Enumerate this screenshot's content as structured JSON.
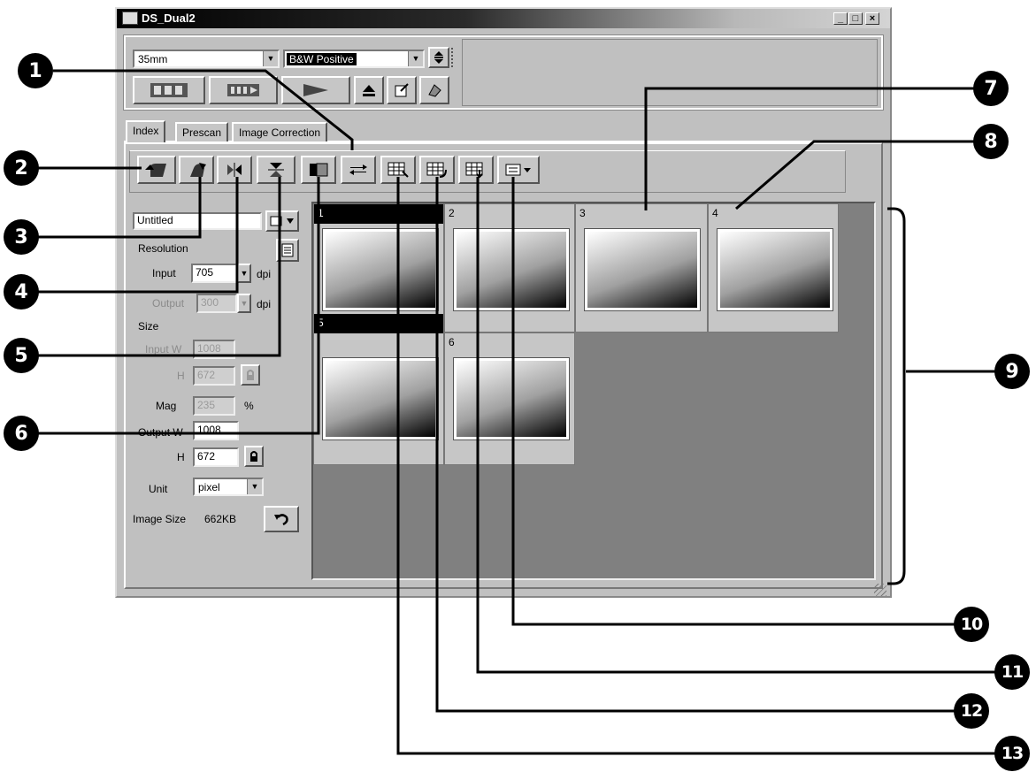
{
  "window": {
    "title": "DS_Dual2",
    "minimize": "_",
    "restore": "□",
    "close": "×"
  },
  "toolbar": {
    "film_type": "35mm",
    "color_mode": "B&W Positive",
    "buttons": [
      "index-scan-icon",
      "prescan-icon",
      "scan-icon",
      "eject-icon",
      "preferences-icon",
      "save-settings-icon"
    ]
  },
  "tabs": [
    "Index",
    "Prescan",
    "Image Correction"
  ],
  "left_panel": {
    "job_name": "Untitled",
    "resolution_label": "Resolution",
    "input_label": "Input",
    "input_value": "705",
    "input_unit": "dpi",
    "output_label": "Output",
    "output_value": "300",
    "output_unit": "dpi",
    "size_label": "Size",
    "input_w_label": "Input W",
    "input_w_value": "1008",
    "input_h_label": "H",
    "input_h_value": "672",
    "mag_label": "Mag",
    "mag_value": "235",
    "mag_unit": "%",
    "output_w_label": "Output W",
    "output_w_value": "1008",
    "output_h_label": "H",
    "output_h_value": "672",
    "unit_label": "Unit",
    "unit_value": "pixel",
    "image_size_label": "Image Size",
    "image_size_value": "662KB"
  },
  "frames": [
    "1",
    "2",
    "3",
    "4",
    "5",
    "6"
  ],
  "callouts": [
    "1",
    "2",
    "3",
    "4",
    "5",
    "6",
    "7",
    "8",
    "9",
    "10",
    "11",
    "12",
    "13"
  ],
  "icons": {
    "rotate_left": "rotate-left-icon",
    "rotate_right": "rotate-right-icon",
    "flip_horizontal": "flip-horizontal-icon",
    "flip_vertical": "flip-vertical-icon",
    "toggle_view": "toggle-view-icon",
    "swap": "swap-icon",
    "select_all": "select-all-frames-icon",
    "prescan_selected": "prescan-selected-icon",
    "scan_selected": "scan-selected-icon",
    "display_mode": "display-mode-icon"
  }
}
